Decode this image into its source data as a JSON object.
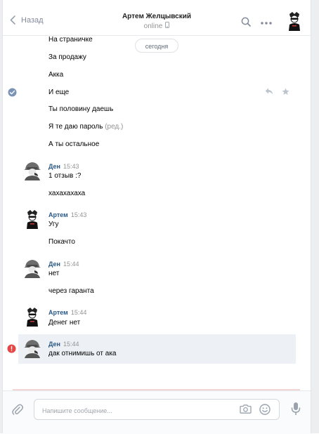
{
  "header": {
    "back_label": "Назад",
    "peer_name": "Артем Желцывский",
    "peer_status": "online"
  },
  "date_separator": "сегодня",
  "own_messages": [
    {
      "text": "На страничке"
    },
    {
      "text": "За продажу"
    },
    {
      "text": "Акка"
    },
    {
      "text": "И еще"
    },
    {
      "text": "Ты половину даешь"
    },
    {
      "text": "Я те даю пароль",
      "edited": "(ред.)"
    },
    {
      "text": "А ты остальное"
    }
  ],
  "groups": [
    {
      "author": "Ден",
      "time": "15:43",
      "messages": [
        "1 отзыв :?",
        "хахахахаха"
      ]
    },
    {
      "author": "Артем",
      "time": "15:43",
      "messages": [
        "Угу",
        "Покачто"
      ]
    },
    {
      "author": "Ден",
      "time": "15:44",
      "messages": [
        "нет",
        "через гаранта"
      ]
    },
    {
      "author": "Артем",
      "time": "15:44",
      "messages": [
        "Денег нет"
      ]
    },
    {
      "author": "Ден",
      "time": "15:44",
      "messages": [
        "дак отнимишь от ака"
      ]
    }
  ],
  "composer": {
    "placeholder": "Напишите сообщение..."
  },
  "colors": {
    "link": "#2a5885",
    "accent": "#5181b8",
    "error": "#e64646",
    "muted": "#939393"
  }
}
